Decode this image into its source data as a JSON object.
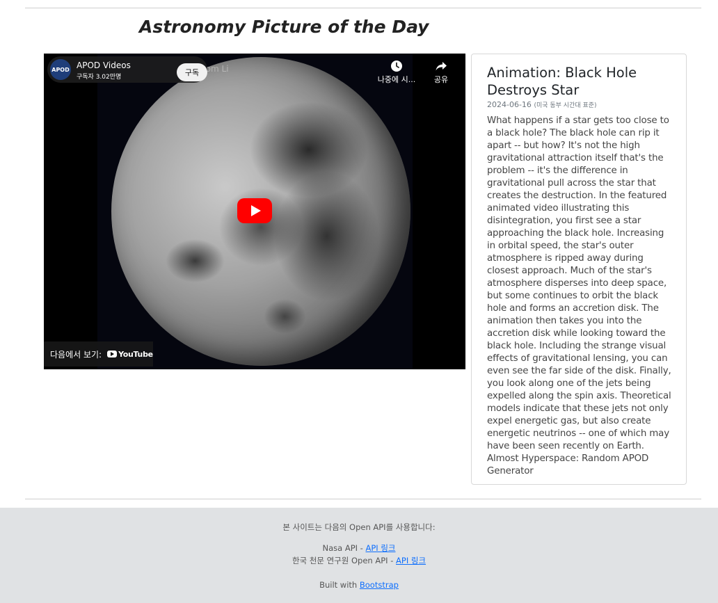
{
  "page": {
    "title": "Astronomy Picture of the Day"
  },
  "video": {
    "channel_name": "APOD Videos",
    "channel_avatar": "APOD",
    "channel_subs": "구독자 3.02만명",
    "video_title_partial": "on from Li",
    "subscribe_label": "구독",
    "watch_later_label": "나중에 시...",
    "share_label": "공유",
    "watch_on_label": "다음에서 보기:",
    "youtube_word": "YouTube",
    "icons": [
      "clock-icon",
      "share-icon",
      "play-icon",
      "youtube-logo-icon"
    ],
    "colors": {
      "play": "#ff0000",
      "background": "#000000"
    }
  },
  "apod": {
    "title": "Animation: Black Hole Destroys Star",
    "date": "2024-06-16",
    "timezone": "(미국 동부 시간대 표준)",
    "explanation": "What happens if a star gets too close to a black hole? The black hole can rip it apart -- but how? It's not the high gravitational attraction itself that's the problem -- it's the difference in gravitational pull across the star that creates the destruction. In the featured animated video illustrating this disintegration, you first see a star approaching the black hole. Increasing in orbital speed, the star's outer atmosphere is ripped away during closest approach. Much of the star's atmosphere disperses into deep space, but some continues to orbit the black hole and forms an accretion disk. The animation then takes you into the accretion disk while looking toward the black hole. Including the strange visual effects of gravitational lensing, you can even see the far side of the disk. Finally, you look along one of the jets being expelled along the spin axis. Theoretical models indicate that these jets not only expel energetic gas, but also create energetic neutrinos -- one of which may have been seen recently on Earth. Almost Hyperspace: Random APOD Generator"
  },
  "footer": {
    "intro": "본 사이트는 다음의 Open API를 사용합니다:",
    "nasa_prefix": "Nasa API - ",
    "nasa_link": "API 링크",
    "kasi_prefix": "한국 천문 연구원 Open API - ",
    "kasi_link": "API 링크",
    "built_prefix": "Built with ",
    "built_link": "Bootstrap",
    "colors": {
      "background": "#e0e2e4",
      "link": "#0d6efd"
    }
  }
}
